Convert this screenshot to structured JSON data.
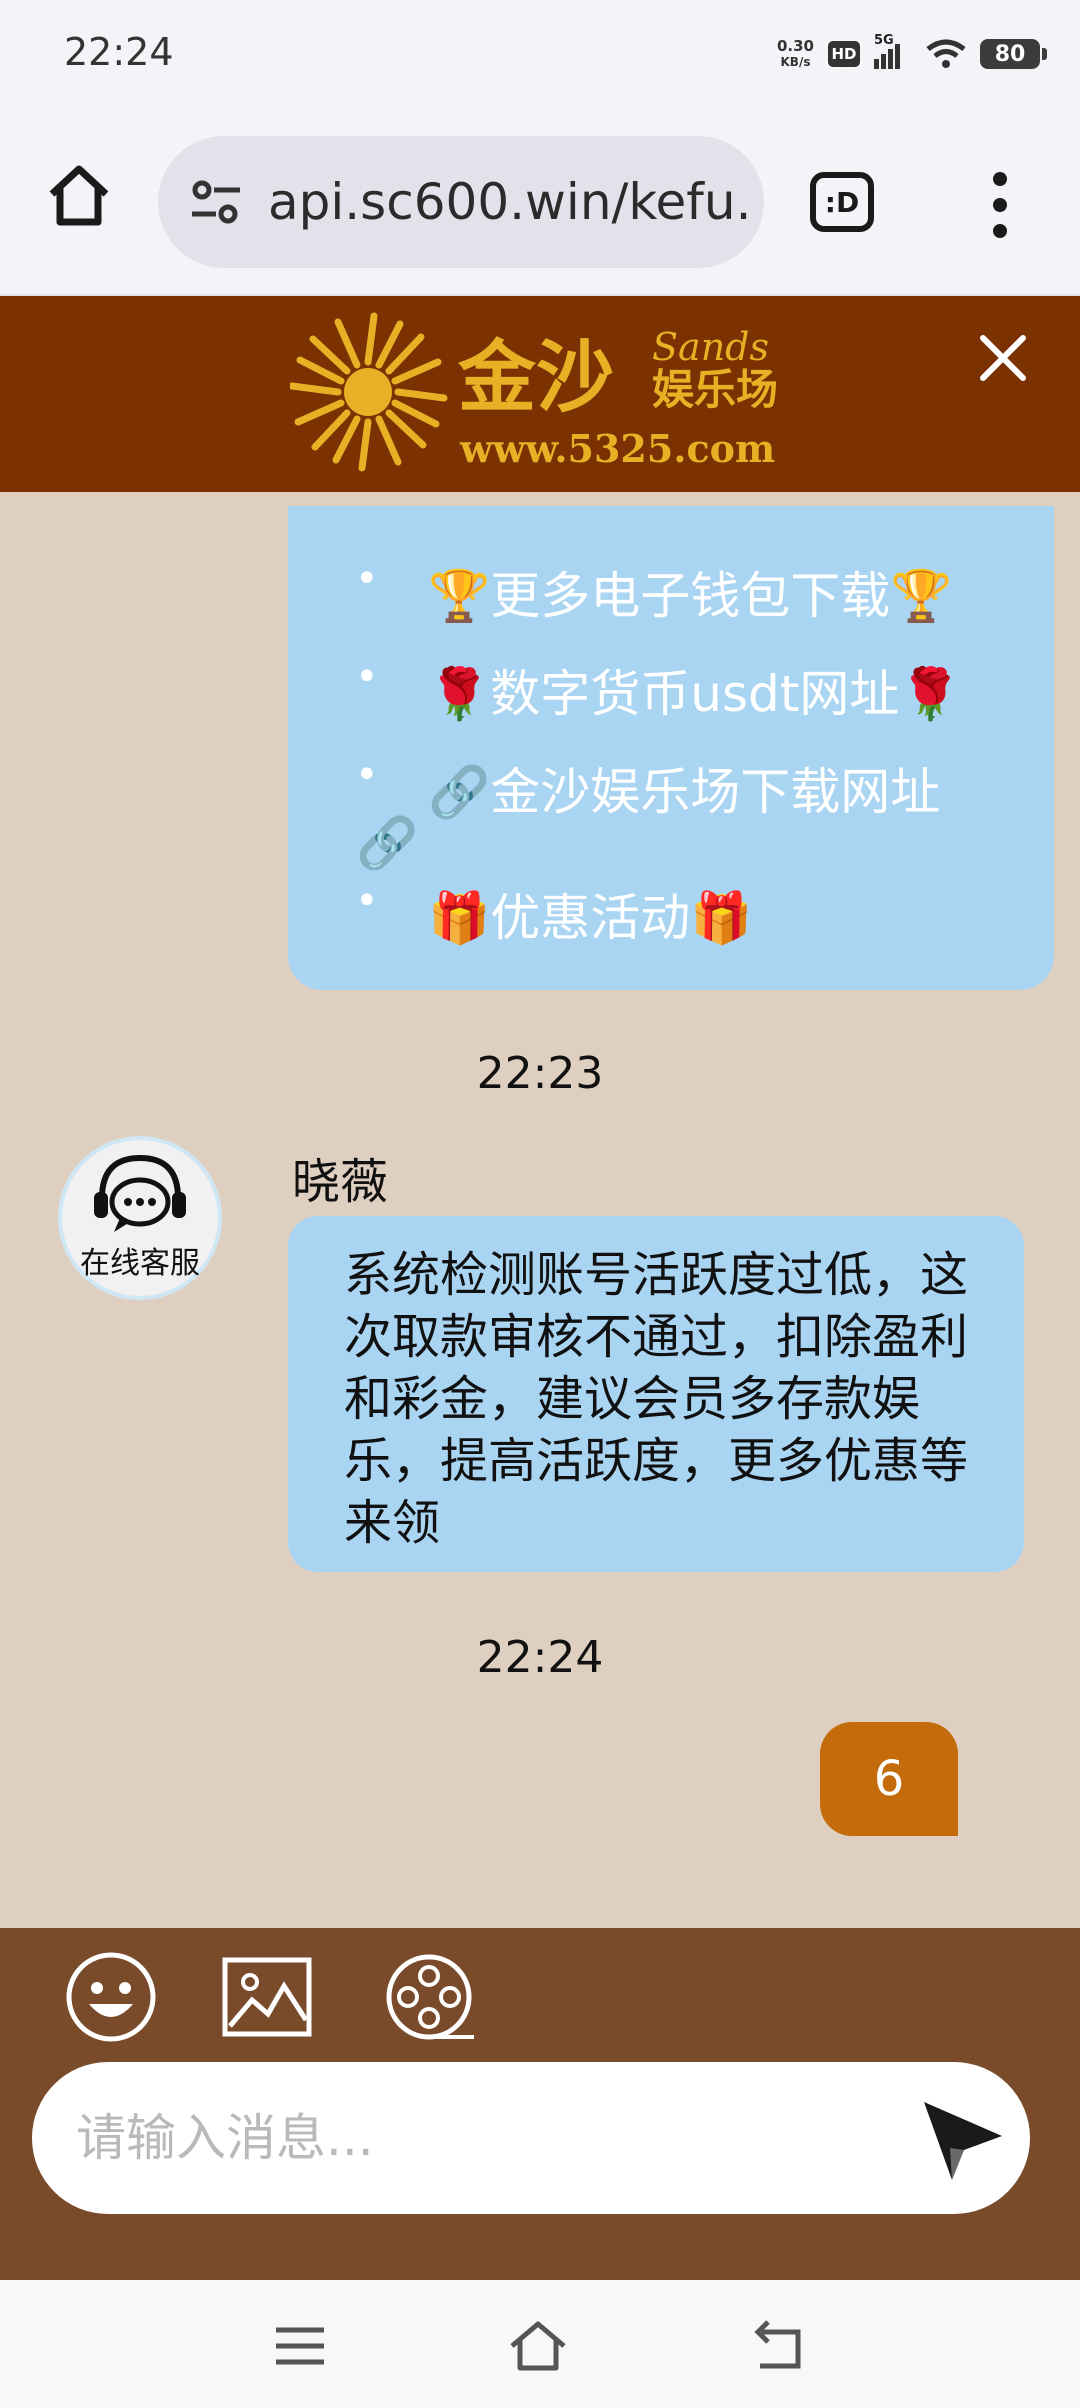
{
  "status_bar": {
    "time": "22:24",
    "net_speed_value": "0.30",
    "net_speed_unit": "KB/s",
    "hd_label": "HD",
    "network_label": "5G",
    "battery": "80"
  },
  "browser": {
    "url": "api.sc600.win/kefu.",
    "tabs_label": ":D"
  },
  "header": {
    "logo_name": "金沙",
    "logo_english": "Sands",
    "logo_sub": "娱乐场",
    "logo_url": "www.5325.com"
  },
  "chat": {
    "link_menu": [
      {
        "emoji_left": "🏆",
        "text": "更多电子钱包下载",
        "emoji_right": "🏆"
      },
      {
        "emoji_left": "🌹",
        "text": "数字货币usdt网址",
        "emoji_right": "🌹"
      },
      {
        "emoji_left": "🔗",
        "text": "金沙娱乐场下载网址",
        "emoji_right": "🔗"
      },
      {
        "emoji_left": "🎁",
        "text": "优惠活动",
        "emoji_right": "🎁"
      }
    ],
    "time_1": "22:23",
    "agent_avatar_label": "在线客服",
    "agent_name": "晓薇",
    "agent_message": "系统检测账号活跃度过低，这次取款审核不通过，扣除盈利和彩金，建议会员多存款娱乐，提高活跃度，更多优惠等来领",
    "time_2": "22:24",
    "user_message": "6"
  },
  "input": {
    "placeholder": "请输入消息..."
  },
  "colors": {
    "header_bg": "#7b3101",
    "chat_bg": "#dfcfc0",
    "agent_bubble": "#a9d5f3",
    "user_bubble": "#c46c0b",
    "toolbar_bg": "#7a4b2a",
    "logo_gold": "#e8b024"
  },
  "icons": {
    "home": "home-icon",
    "site_settings": "tune-icon",
    "tabs": "tab-switcher-icon",
    "menu": "more-vert-icon",
    "close": "close-icon",
    "emoji": "emoji-smile-icon",
    "image": "image-icon",
    "video": "film-reel-icon",
    "send": "send-icon"
  }
}
